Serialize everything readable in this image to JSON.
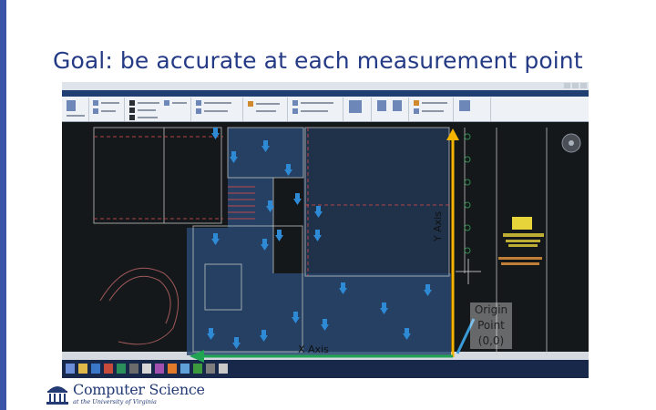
{
  "slide": {
    "title": "Goal: be accurate at each measurement point"
  },
  "colors": {
    "accent_bar": "#3a55a8",
    "title": "#243a85",
    "y_axis_arrow": "#f4b400",
    "x_axis_arrow": "#21a552",
    "origin_pointer": "#3a9bd9",
    "measurement_marker": "#2f8ad6",
    "drawing_bg": "#15181b",
    "room_highlight": "#2a4f7c"
  },
  "annotations": {
    "y_axis_label": "Y Axis",
    "x_axis_label": "X Axis",
    "origin_line1": "Origin",
    "origin_line2": "Point",
    "origin_line3": "(0,0)"
  },
  "icons": {
    "measurement_point": "arrow-down-icon",
    "logo": "rotunda-icon",
    "compass": "compass-icon"
  },
  "logo": {
    "name": "Computer Science",
    "sub": "at the University of Virginia"
  }
}
